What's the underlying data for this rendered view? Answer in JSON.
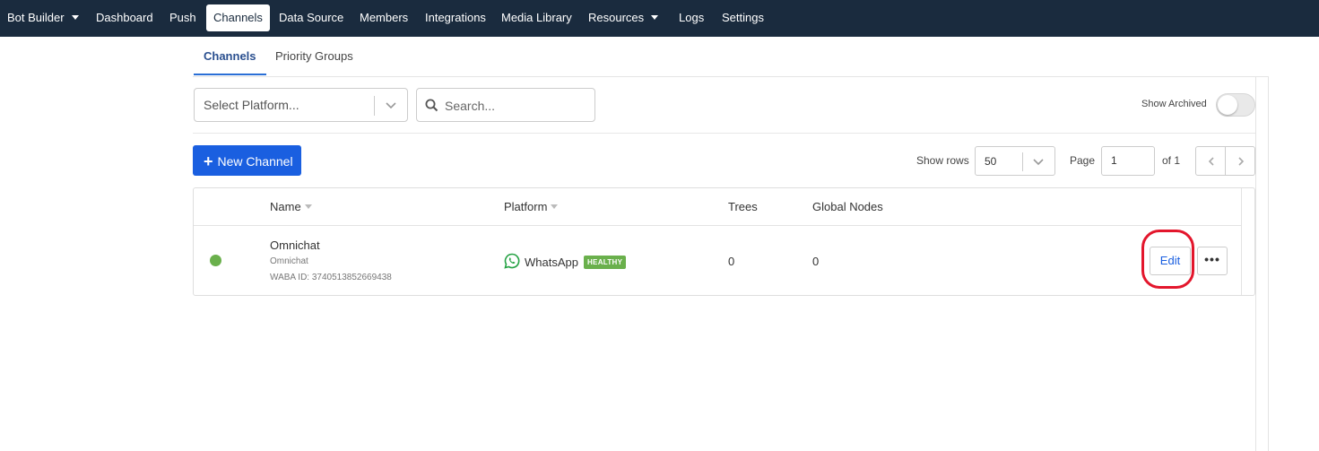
{
  "nav": {
    "items": [
      {
        "label": "Bot Builder",
        "has_caret": true
      },
      {
        "label": "Dashboard"
      },
      {
        "label": "Push"
      },
      {
        "label": "Channels",
        "active": true
      },
      {
        "label": "Data Source"
      },
      {
        "label": "Members"
      },
      {
        "label": "Integrations"
      },
      {
        "label": "Media Library"
      },
      {
        "label": "Resources",
        "has_caret": true
      },
      {
        "label": "Logs"
      },
      {
        "label": "Settings"
      }
    ]
  },
  "subtabs": [
    {
      "label": "Channels",
      "active": true
    },
    {
      "label": "Priority Groups"
    }
  ],
  "filters": {
    "platform_placeholder": "Select Platform...",
    "search_placeholder": "Search...",
    "show_archived_label": "Show Archived",
    "show_archived": false
  },
  "toolbar": {
    "new_channel_label": "New Channel",
    "show_rows_label": "Show rows",
    "rows_value": "50",
    "page_label": "Page",
    "page_value": "1",
    "of_label": "of 1"
  },
  "table": {
    "columns": [
      "Name",
      "Platform",
      "Trees",
      "Global Nodes"
    ],
    "rows": [
      {
        "status_color": "#6ab04c",
        "name": "Omnichat",
        "subname": "Omnichat",
        "waba_id": "WABA ID: 3740513852669438",
        "platform": "WhatsApp",
        "platform_icon": "whatsapp-icon",
        "health": "HEALTHY",
        "trees": "0",
        "global_nodes": "0",
        "edit_label": "Edit",
        "more_label": "•••"
      }
    ]
  },
  "colors": {
    "nav_bg": "#1a2b3e",
    "primary": "#1a5fe0",
    "healthy": "#6ab04c",
    "highlight": "#e3162c"
  }
}
